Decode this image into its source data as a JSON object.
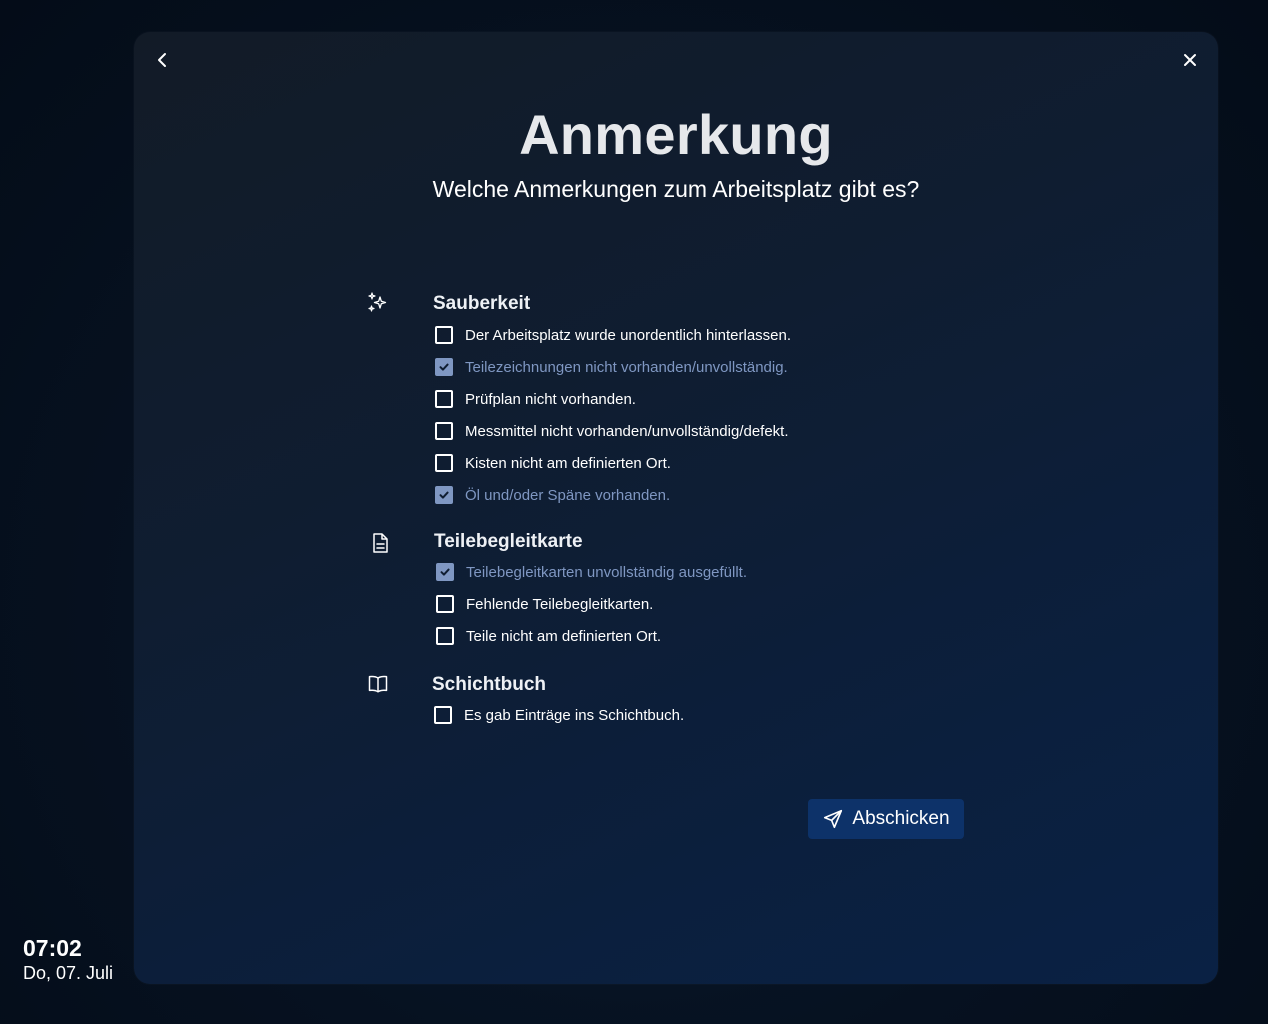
{
  "dialog": {
    "title": "Anmerkung",
    "subtitle": "Welche Anmerkungen zum Arbeitsplatz gibt es?",
    "back_icon": "chevron-left-icon",
    "close_icon": "close-icon"
  },
  "sections": [
    {
      "title": "Sauberkeit",
      "icon": "sparkles-icon",
      "options": [
        {
          "label": "Der Arbeitsplatz wurde unordentlich hinterlassen.",
          "checked": false
        },
        {
          "label": "Teilezeichnungen nicht vorhanden/unvollständig.",
          "checked": true
        },
        {
          "label": "Prüfplan nicht vorhanden.",
          "checked": false
        },
        {
          "label": "Messmittel nicht vorhanden/unvollständig/defekt.",
          "checked": false
        },
        {
          "label": "Kisten nicht am definierten Ort.",
          "checked": false
        },
        {
          "label": "Öl und/oder Späne vorhanden.",
          "checked": true
        }
      ]
    },
    {
      "title": "Teilebegleitkarte",
      "icon": "document-icon",
      "options": [
        {
          "label": "Teilebegleitkarten unvollständig ausgefüllt.",
          "checked": true
        },
        {
          "label": "Fehlende Teilebegleitkarten.",
          "checked": false
        },
        {
          "label": "Teile nicht am definierten Ort.",
          "checked": false
        }
      ]
    },
    {
      "title": "Schichtbuch",
      "icon": "book-icon",
      "options": [
        {
          "label": "Es gab Einträge ins Schichtbuch.",
          "checked": false
        }
      ]
    }
  ],
  "submit": {
    "label": "Abschicken",
    "icon": "send-icon"
  },
  "clock": {
    "time": "07:02",
    "date": "Do, 07. Juli"
  },
  "colors": {
    "accent": "#0d3269",
    "checked": "#7f97c2"
  }
}
